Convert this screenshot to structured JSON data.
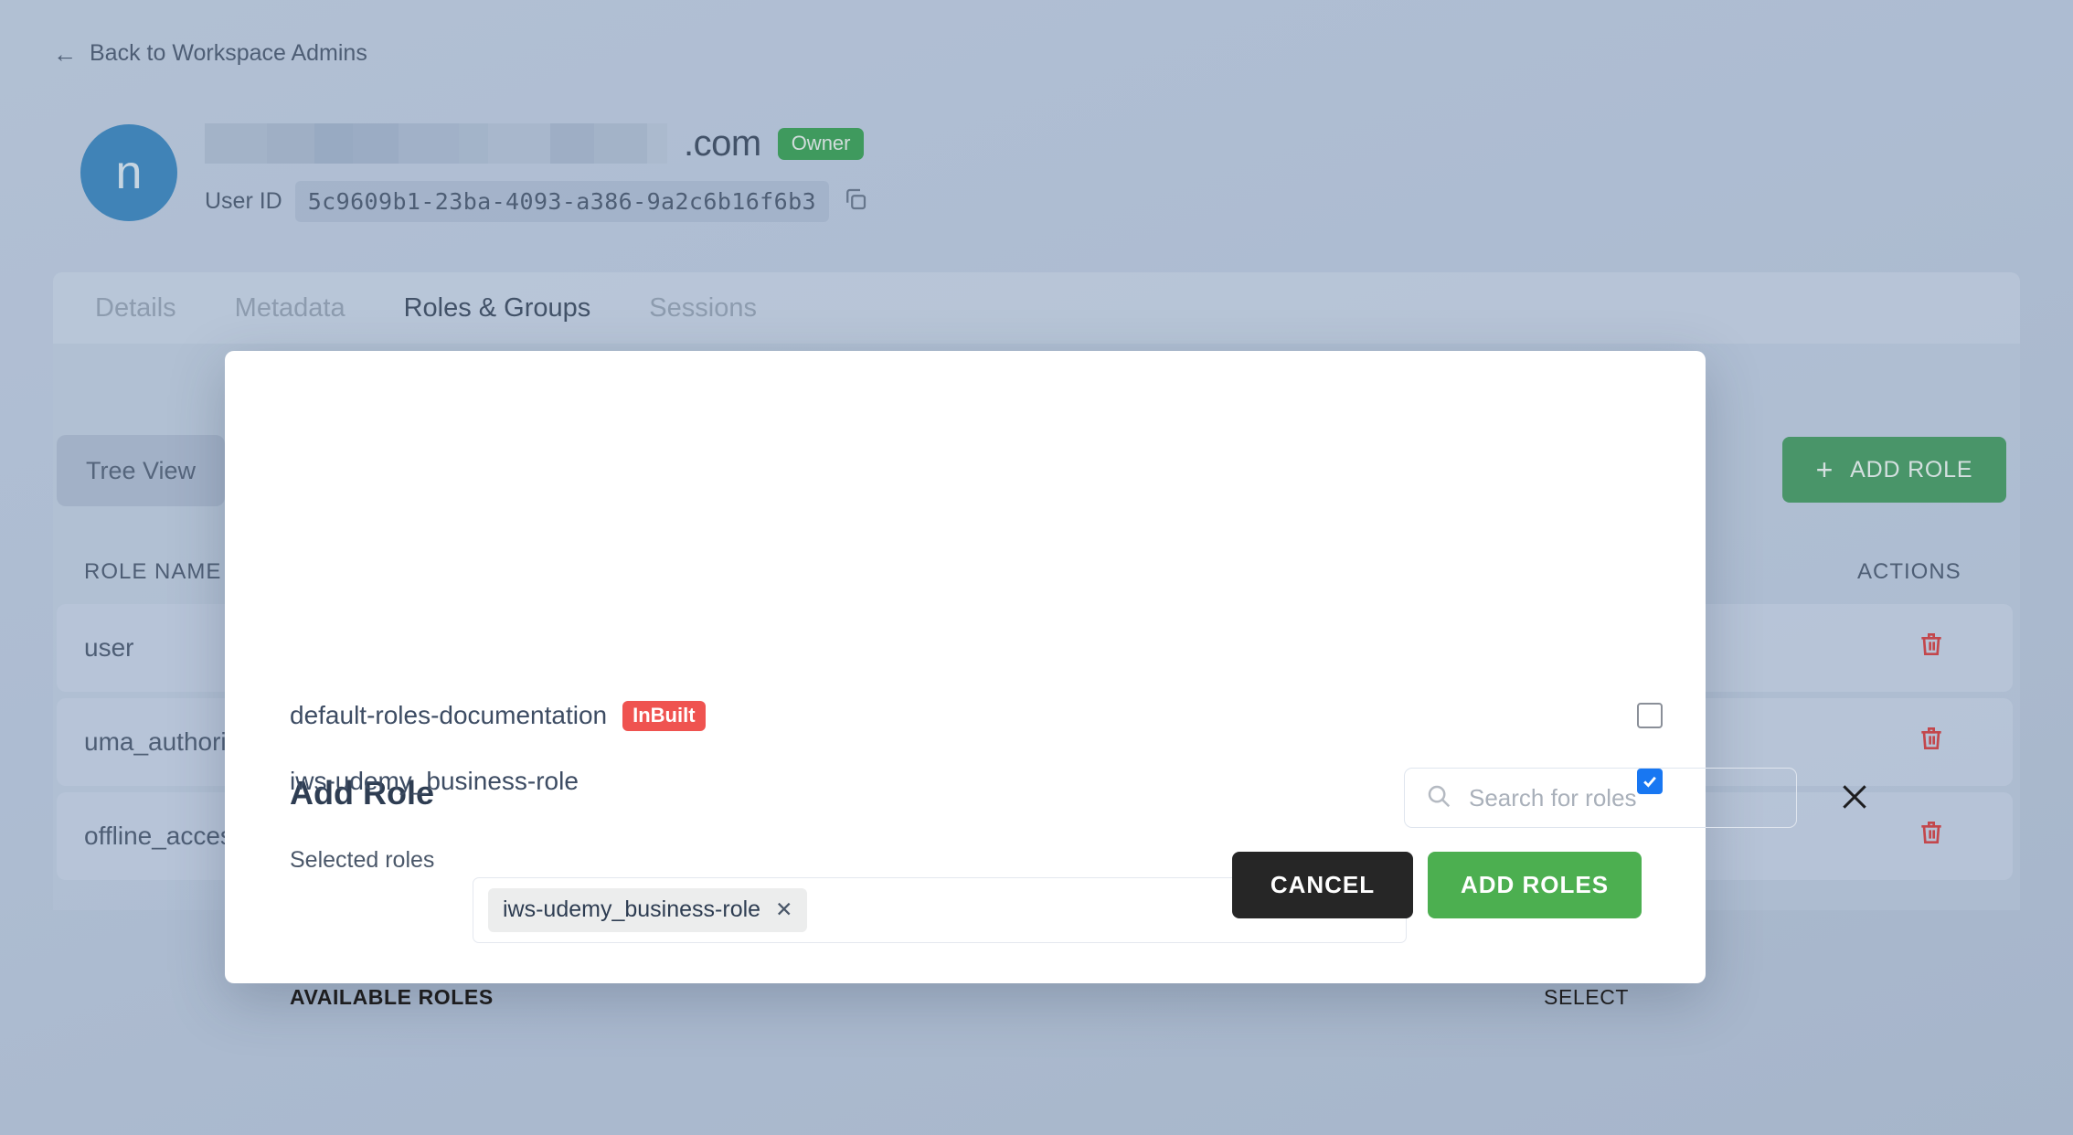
{
  "back_link": {
    "label": "Back to Workspace Admins",
    "icon": "arrow-left-icon"
  },
  "user": {
    "avatar_initial": "n",
    "avatar_color": "#2b7cb8",
    "name_redacted": true,
    "domain_suffix": ".com",
    "owner_badge": "Owner",
    "owner_badge_color": "#2a9946",
    "user_id_label": "User ID",
    "user_id_value": "5c9609b1-23ba-4093-a386-9a2c6b16f6b3",
    "copy_icon": "copy-icon"
  },
  "tabs": [
    {
      "label": "Details",
      "active": false
    },
    {
      "label": "Metadata",
      "active": false
    },
    {
      "label": "Roles & Groups",
      "active": true
    },
    {
      "label": "Sessions",
      "active": false
    }
  ],
  "roles_panel": {
    "tree_view_label": "Tree View",
    "add_role_label": "ADD ROLE",
    "add_role_color": "#369354",
    "columns": {
      "role_name": "ROLE NAME",
      "actions": "ACTIONS"
    },
    "rows": [
      {
        "name": "user",
        "action_icon": "trash-icon"
      },
      {
        "name": "uma_authorization",
        "action_icon": "trash-icon"
      },
      {
        "name": "offline_access",
        "action_icon": "trash-icon"
      }
    ],
    "trash_color": "#d32f2f"
  },
  "modal": {
    "title": "Add Role",
    "close_icon": "close-icon",
    "search": {
      "placeholder": "Search for roles",
      "value": "",
      "icon": "search-icon"
    },
    "selected_roles_label": "Selected roles",
    "selected_roles": [
      {
        "label": "iws-udemy_business-role",
        "remove_icon": "close-icon"
      }
    ],
    "available_roles_label": "AVAILABLE ROLES",
    "select_column_label": "SELECT",
    "available_roles": [
      {
        "name": "default-roles-documentation",
        "badge": "InBuilt",
        "badge_color": "#ef5350",
        "checked": false
      },
      {
        "name": "iws-udemy_business-role",
        "badge": "",
        "badge_color": "",
        "checked": true
      }
    ],
    "cancel_label": "CANCEL",
    "confirm_label": "ADD ROLES",
    "cancel_color": "#262626",
    "confirm_color": "#4caf50",
    "checkbox_checked_color": "#1877f2"
  }
}
